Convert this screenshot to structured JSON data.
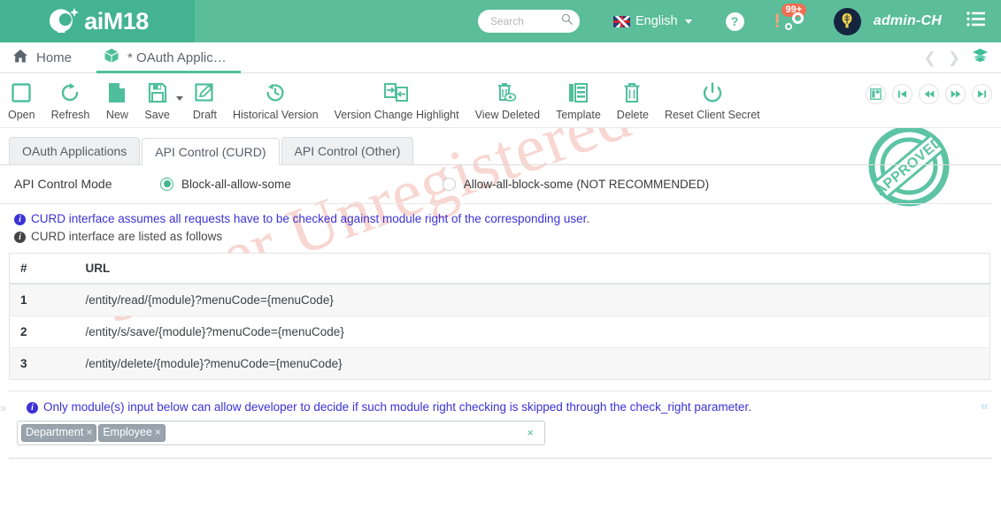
{
  "brand": {
    "name": "aiM18",
    "logo_icon": "aim18-logo-icon",
    "accent": "#43b390",
    "header_bg": "#5bbd9a"
  },
  "topbar": {
    "search": {
      "placeholder": "Search",
      "value": "",
      "icon": "search-icon"
    },
    "language": {
      "label": "English",
      "flag_icon": "uk-flag-icon",
      "caret_icon": "chevron-down-icon"
    },
    "help": {
      "label": "?",
      "icon": "help-icon"
    },
    "alerts": {
      "bang": "!",
      "badge": "99+",
      "gear_icon": "gear-icon"
    },
    "user": {
      "name": "admin-CH",
      "avatar_icon": "user-avatar-icon"
    },
    "menu_icon": "hamburger-menu-icon"
  },
  "tabstrip": {
    "tabs": [
      {
        "label": "Home",
        "icon": "home-icon",
        "active": false
      },
      {
        "label": "* OAuth Applic…",
        "icon": "box-icon",
        "active": true
      }
    ],
    "prev_icon": "chevron-left-icon",
    "next_icon": "chevron-right-icon",
    "layers_icon": "layers-icon"
  },
  "toolbar": {
    "buttons": [
      {
        "label": "Open",
        "icon": "open-square-icon"
      },
      {
        "label": "Refresh",
        "icon": "refresh-icon"
      },
      {
        "label": "New",
        "icon": "new-document-icon"
      },
      {
        "label": "Save",
        "icon": "save-floppy-icon"
      },
      {
        "label": "Draft",
        "icon": "draft-pencil-icon"
      },
      {
        "label": "Historical Version",
        "icon": "history-clock-icon"
      },
      {
        "label": "Version Change Highlight",
        "icon": "version-compare-icon"
      },
      {
        "label": "View Deleted",
        "icon": "view-deleted-icon"
      },
      {
        "label": "Template",
        "icon": "template-grid-icon"
      },
      {
        "label": "Delete",
        "icon": "trash-icon"
      },
      {
        "label": "Reset Client Secret",
        "icon": "power-icon"
      }
    ],
    "save_caret_icon": "caret-down-icon",
    "nav_buttons": [
      {
        "icon": "panel-layout-icon"
      },
      {
        "icon": "first-record-icon"
      },
      {
        "icon": "previous-record-icon"
      },
      {
        "icon": "next-record-icon"
      },
      {
        "icon": "last-record-icon"
      }
    ]
  },
  "subtabs": [
    {
      "label": "OAuth Applications",
      "active": false
    },
    {
      "label": "API Control (CURD)",
      "active": true
    },
    {
      "label": "API Control (Other)",
      "active": false
    }
  ],
  "api_control_mode": {
    "label": "API Control Mode",
    "options": [
      {
        "label": "Block-all-allow-some",
        "selected": true
      },
      {
        "label": "Allow-all-block-some (NOT RECOMMENDED)",
        "selected": false
      }
    ]
  },
  "notes": [
    {
      "text": "CURD interface assumes all requests have to be checked against module right of the corresponding user.",
      "style": "blue",
      "icon": "info-icon"
    },
    {
      "text": "CURD interface are listed as follows",
      "style": "dark",
      "icon": "info-icon"
    }
  ],
  "url_table": {
    "headers": [
      "#",
      "URL"
    ],
    "rows": [
      {
        "index": "1",
        "url": "/entity/read/{module}?menuCode={menuCode}"
      },
      {
        "index": "2",
        "url": "/entity/s/save/{module}?menuCode={menuCode}"
      },
      {
        "index": "3",
        "url": "/entity/delete/{module}?menuCode={menuCode}"
      }
    ]
  },
  "bottom": {
    "note": "Only module(s) input below can allow developer to decide if such module right checking is skipped through the check_right parameter.",
    "note_icon": "info-icon",
    "collapse_left_icon": "chevron-double-right-icon",
    "collapse_right_icon": "chevron-double-left-icon",
    "tags": [
      {
        "label": "Department",
        "remove_icon": "close-icon"
      },
      {
        "label": "Employee",
        "remove_icon": "close-icon"
      }
    ],
    "clear_icon": "clear-all-icon",
    "clear_label": "×"
  },
  "stamp": {
    "text": "APPROVED",
    "color": "#4fbf9b"
  },
  "watermark": {
    "text": "Server Unregistered",
    "color": "#f7cfc9"
  }
}
